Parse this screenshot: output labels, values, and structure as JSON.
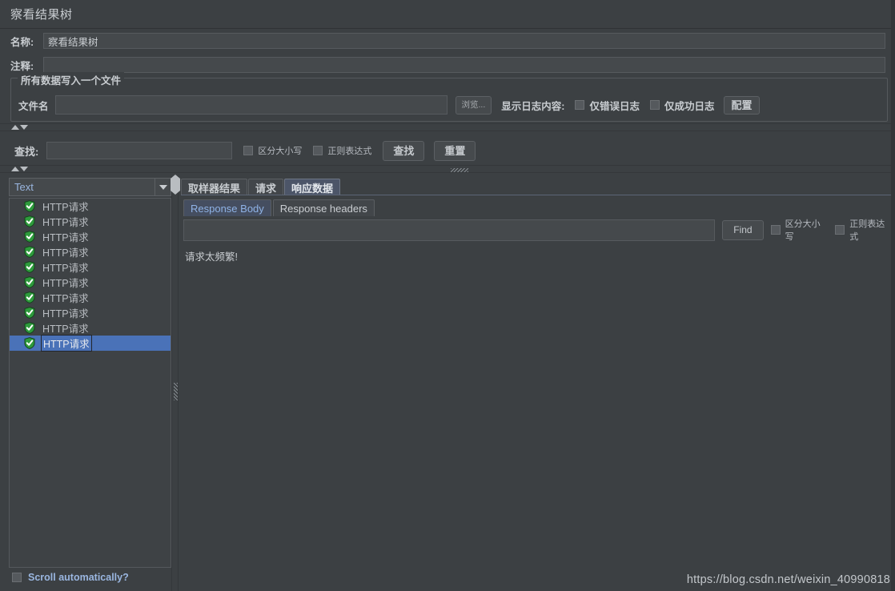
{
  "window": {
    "title": "察看结果树"
  },
  "form": {
    "name_label": "名称:",
    "name_value": "察看结果树",
    "comment_label": "注释:",
    "comment_value": ""
  },
  "file_group": {
    "group_title": "所有数据写入一个文件",
    "filename_label": "文件名",
    "filename_value": "",
    "browse_button": "浏览...",
    "log_display_label": "显示日志内容:",
    "errors_only_label": "仅错误日志",
    "errors_only_checked": false,
    "successes_only_label": "仅成功日志",
    "successes_only_checked": false,
    "configure_button": "配置"
  },
  "search_bar": {
    "find_label": "查找:",
    "find_value": "",
    "case_sensitive_label": "区分大小写",
    "case_sensitive_checked": false,
    "regex_label": "正则表达式",
    "regex_checked": false,
    "find_button": "查找",
    "reset_button": "重置"
  },
  "tree_panel": {
    "renderer_selected": "Text",
    "renderer_options": [
      "Text"
    ],
    "items": [
      {
        "label": "HTTP请求",
        "status": "success",
        "selected": false
      },
      {
        "label": "HTTP请求",
        "status": "success",
        "selected": false
      },
      {
        "label": "HTTP请求",
        "status": "success",
        "selected": false
      },
      {
        "label": "HTTP请求",
        "status": "success",
        "selected": false
      },
      {
        "label": "HTTP请求",
        "status": "success",
        "selected": false
      },
      {
        "label": "HTTP请求",
        "status": "success",
        "selected": false
      },
      {
        "label": "HTTP请求",
        "status": "success",
        "selected": false
      },
      {
        "label": "HTTP请求",
        "status": "success",
        "selected": false
      },
      {
        "label": "HTTP请求",
        "status": "success",
        "selected": false
      },
      {
        "label": "HTTP请求",
        "status": "success",
        "selected": true
      }
    ],
    "scroll_automatically_label": "Scroll automatically?",
    "scroll_automatically_checked": false
  },
  "result_panel": {
    "tabs": [
      {
        "label": "取样器结果",
        "active": false
      },
      {
        "label": "请求",
        "active": false
      },
      {
        "label": "响应数据",
        "active": true
      }
    ],
    "subtabs": [
      {
        "label": "Response Body",
        "active": true
      },
      {
        "label": "Response headers",
        "active": false
      }
    ],
    "find_value": "",
    "find_button": "Find",
    "case_sensitive_label": "区分大小写",
    "case_sensitive_checked": false,
    "regex_label": "正则表达式",
    "regex_checked": false,
    "response_text": "请求太频繁!"
  },
  "watermark": {
    "text": "https://blog.csdn.net/weixin_40990818"
  },
  "colors": {
    "background": "#3c4043",
    "field_background": "#45494c",
    "text": "#c9cdd1",
    "accent_blue": "#4a72b8",
    "link_blue": "#9ab6e0",
    "success_green": "#2e9b3c"
  }
}
